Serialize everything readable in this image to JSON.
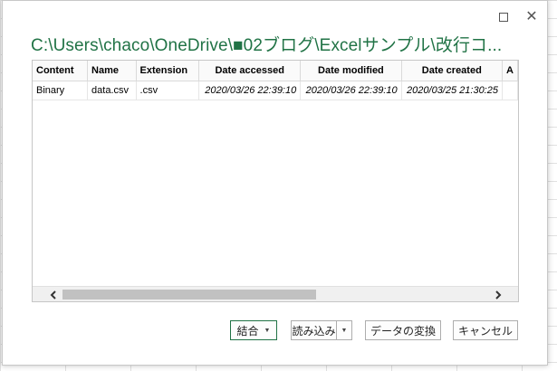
{
  "window": {
    "title": "C:\\Users\\chaco\\OneDrive\\■02ブログ\\Excelサンプル\\改行コ...",
    "maximize_icon": "maximize-icon",
    "close_label": "✕"
  },
  "table": {
    "columns": [
      "Content",
      "Name",
      "Extension",
      "Date accessed",
      "Date modified",
      "Date created",
      "A"
    ],
    "rows": [
      {
        "content": "Binary",
        "name": "data.csv",
        "extension": ".csv",
        "date_accessed": "2020/03/26 22:39:10",
        "date_modified": "2020/03/26 22:39:10",
        "date_created": "2020/03/25 21:30:25"
      }
    ]
  },
  "buttons": {
    "combine": "結合",
    "load": "読み込み",
    "transform": "データの変換",
    "cancel": "キャンセル"
  },
  "colors": {
    "accent": "#217346"
  }
}
